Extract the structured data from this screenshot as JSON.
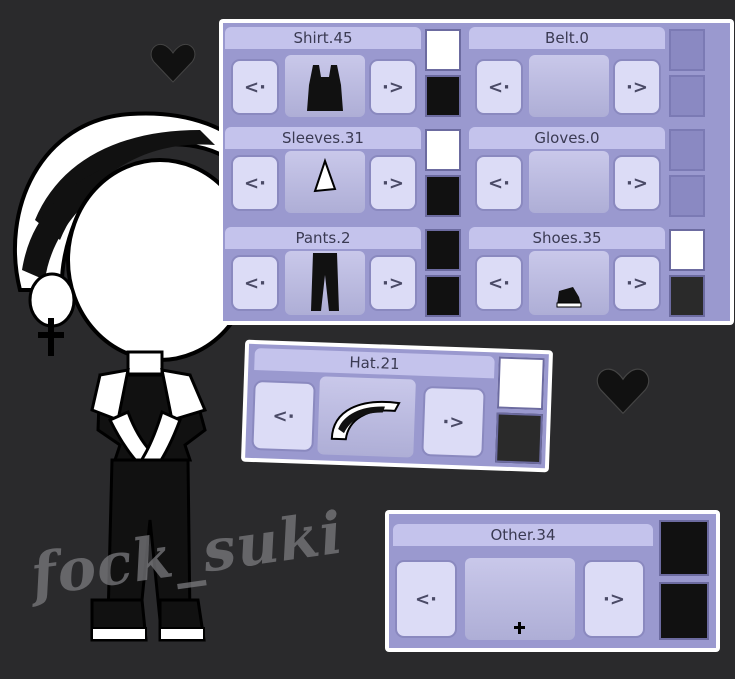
{
  "slots": {
    "shirt": "Shirt.45",
    "belt": "Belt.0",
    "sleeves": "Sleeves.31",
    "gloves": "Gloves.0",
    "pants": "Pants.2",
    "shoes": "Shoes.35",
    "hat": "Hat.21",
    "other": "Other.34"
  },
  "arrows": {
    "prev": "<·",
    "next": "·>"
  },
  "watermark": "fock_suki",
  "colors": {
    "panel": "#9a99cf",
    "label_bg": "#c4c3ec",
    "button_bg": "#dcdcf6",
    "background": "#2a2a2c"
  }
}
